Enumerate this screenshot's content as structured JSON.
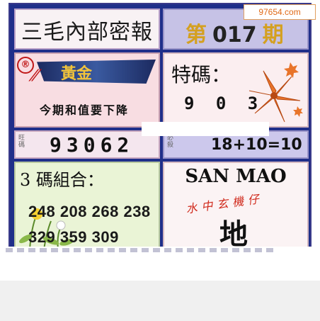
{
  "watermark": "97654.com",
  "title": "三毛內部密報",
  "issue": {
    "prefix": "第",
    "number": "017",
    "suffix": "期"
  },
  "gold": {
    "badge": "®",
    "label": "黃金",
    "note": "今期和值要下降"
  },
  "special": {
    "label": "特碼：",
    "numbers": "9 0 3"
  },
  "wang": {
    "tag": "旺碼",
    "numbers": "93062"
  },
  "calc": {
    "tag": "必殺",
    "expression": "18+10=10"
  },
  "combo": {
    "title": "3 碼組合：",
    "line1": "248 208 268 238",
    "line2": "329 359 309"
  },
  "sanmao": {
    "title": "SAN MAO",
    "subtitle": "水中玄機仔",
    "big": "地"
  },
  "colors": {
    "border": "#1f2f8a",
    "gold": "#f2c43a",
    "red": "#c01818"
  }
}
